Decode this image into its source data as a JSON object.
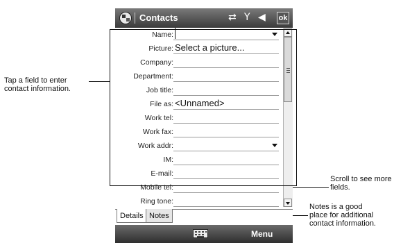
{
  "callouts": {
    "tap_field": [
      "Tap a field to enter",
      "contact information."
    ],
    "scroll": [
      "Scroll to see more",
      "fields."
    ],
    "notes": [
      "Notes is a good",
      "place for additional",
      "contact information."
    ]
  },
  "titlebar": {
    "title": "Contacts",
    "ok_label": "ok",
    "icons": [
      "start-icon",
      "connectivity-icon",
      "signal-icon",
      "volume-icon"
    ]
  },
  "fields": [
    {
      "label": "Name:",
      "value": "",
      "dropdown": true
    },
    {
      "label": "Picture:",
      "value": "Select a picture...",
      "dropdown": false
    },
    {
      "label": "Company:",
      "value": "",
      "dropdown": false
    },
    {
      "label": "Department:",
      "value": "",
      "dropdown": false
    },
    {
      "label": "Job title:",
      "value": "",
      "dropdown": false
    },
    {
      "label": "File as:",
      "value": "<Unnamed>",
      "dropdown": false
    },
    {
      "label": "Work tel:",
      "value": "",
      "dropdown": false
    },
    {
      "label": "Work fax:",
      "value": "",
      "dropdown": false
    },
    {
      "label": "Work addr:",
      "value": "",
      "dropdown": true
    },
    {
      "label": "IM:",
      "value": "",
      "dropdown": false
    },
    {
      "label": "E-mail:",
      "value": "",
      "dropdown": false
    },
    {
      "label": "Mobile tel:",
      "value": "",
      "dropdown": false
    },
    {
      "label": "Ring tone:",
      "value": "",
      "dropdown": false
    }
  ],
  "tabs": {
    "details": "Details",
    "notes": "Notes"
  },
  "menubar": {
    "menu_label": "Menu"
  }
}
